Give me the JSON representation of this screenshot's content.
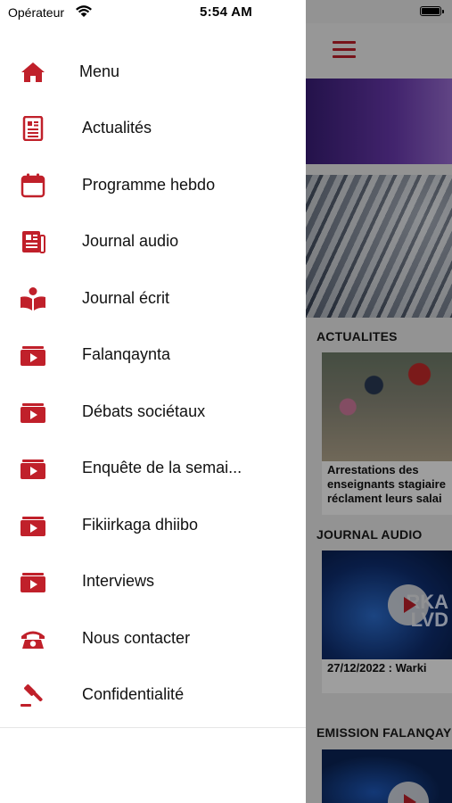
{
  "status_bar": {
    "carrier": "Opérateur",
    "time": "5:54 AM"
  },
  "menu": {
    "items": [
      {
        "label": "Menu",
        "icon": "home-icon"
      },
      {
        "label": "Actualités",
        "icon": "news-icon"
      },
      {
        "label": "Programme hebdo",
        "icon": "calendar-icon"
      },
      {
        "label": "Journal audio",
        "icon": "newspaper-icon"
      },
      {
        "label": "Journal écrit",
        "icon": "reading-icon"
      },
      {
        "label": "Falanqaynta",
        "icon": "video-icon"
      },
      {
        "label": "Débats sociétaux",
        "icon": "video-icon"
      },
      {
        "label": "Enquête de la semai...",
        "icon": "video-icon"
      },
      {
        "label": "Fikiirkaga dhiibo",
        "icon": "video-icon"
      },
      {
        "label": "Interviews",
        "icon": "video-icon"
      },
      {
        "label": "Nous contacter",
        "icon": "phone-icon"
      },
      {
        "label": "Confidentialité",
        "icon": "gavel-icon"
      }
    ]
  },
  "background": {
    "sections": {
      "actualites": {
        "title": "ACTUALITES",
        "card_title_lines": [
          "Arrestations des",
          "enseignants stagiaire",
          "réclament leurs salai"
        ]
      },
      "journal_audio": {
        "title": "JOURNAL AUDIO",
        "card_title": "27/12/2022 : Warki",
        "thumb_text": [
          "RKA",
          "LVD"
        ]
      },
      "emission": {
        "title": "EMISSION FALANQAY"
      }
    }
  },
  "colors": {
    "accent": "#c0202a",
    "drawer_bg": "#ffffff",
    "scrim": "rgba(0,0,0,0.38)"
  }
}
